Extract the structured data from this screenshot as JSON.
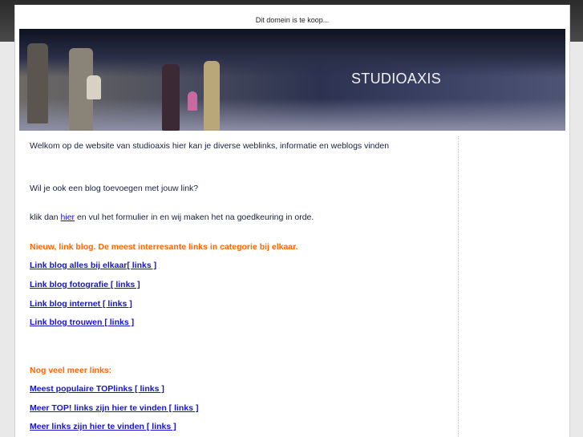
{
  "notice": "Dit domein is te koop...",
  "banner": {
    "title": "STUDIOAXIS"
  },
  "content": {
    "welcome": "Welkom op de website van studioaxis hier kan je diverse weblinks, informatie en weblogs vinden",
    "question": "Wil je ook een blog toevoegen met jouw link?",
    "click_prefix": "klik dan ",
    "click_link": "hier",
    "click_suffix": " en vul het formulier in en wij maken het na goedkeuring in orde.",
    "section1_heading": "Nieuw, link blog. De meest interresante links in categorie bij elkaar.",
    "section1_links": [
      "Link blog alles bij elkaar[ links ] ",
      "Link blog fotografie [ links ]",
      "Link blog internet [ links ] ",
      "Link blog trouwen [ links ] "
    ],
    "section2_heading": "Nog veel meer links:",
    "section2_links": [
      "Meest populaire TOPlinks [ links ] ",
      "Meer TOP! links zijn hier te vinden [ links ] ",
      "Meer links zijn hier te vinden [ links ] "
    ]
  }
}
